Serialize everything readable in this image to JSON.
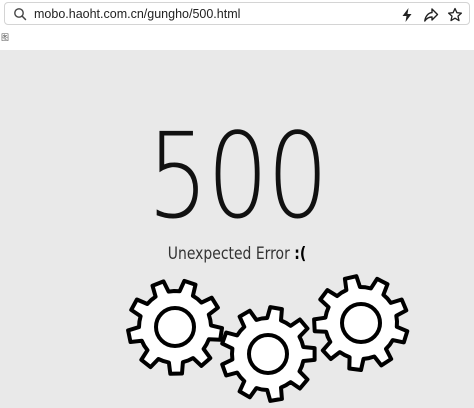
{
  "browser": {
    "url": "mobo.haoht.com.cn/gungho/500.html",
    "icons": [
      "search-icon",
      "lightning-icon",
      "share-icon",
      "star-icon"
    ]
  },
  "page": {
    "broken_image_alt": "图",
    "error_code": "500",
    "message": "Unexpected Error",
    "face": ":(",
    "background_color": "#e9e9e9"
  }
}
